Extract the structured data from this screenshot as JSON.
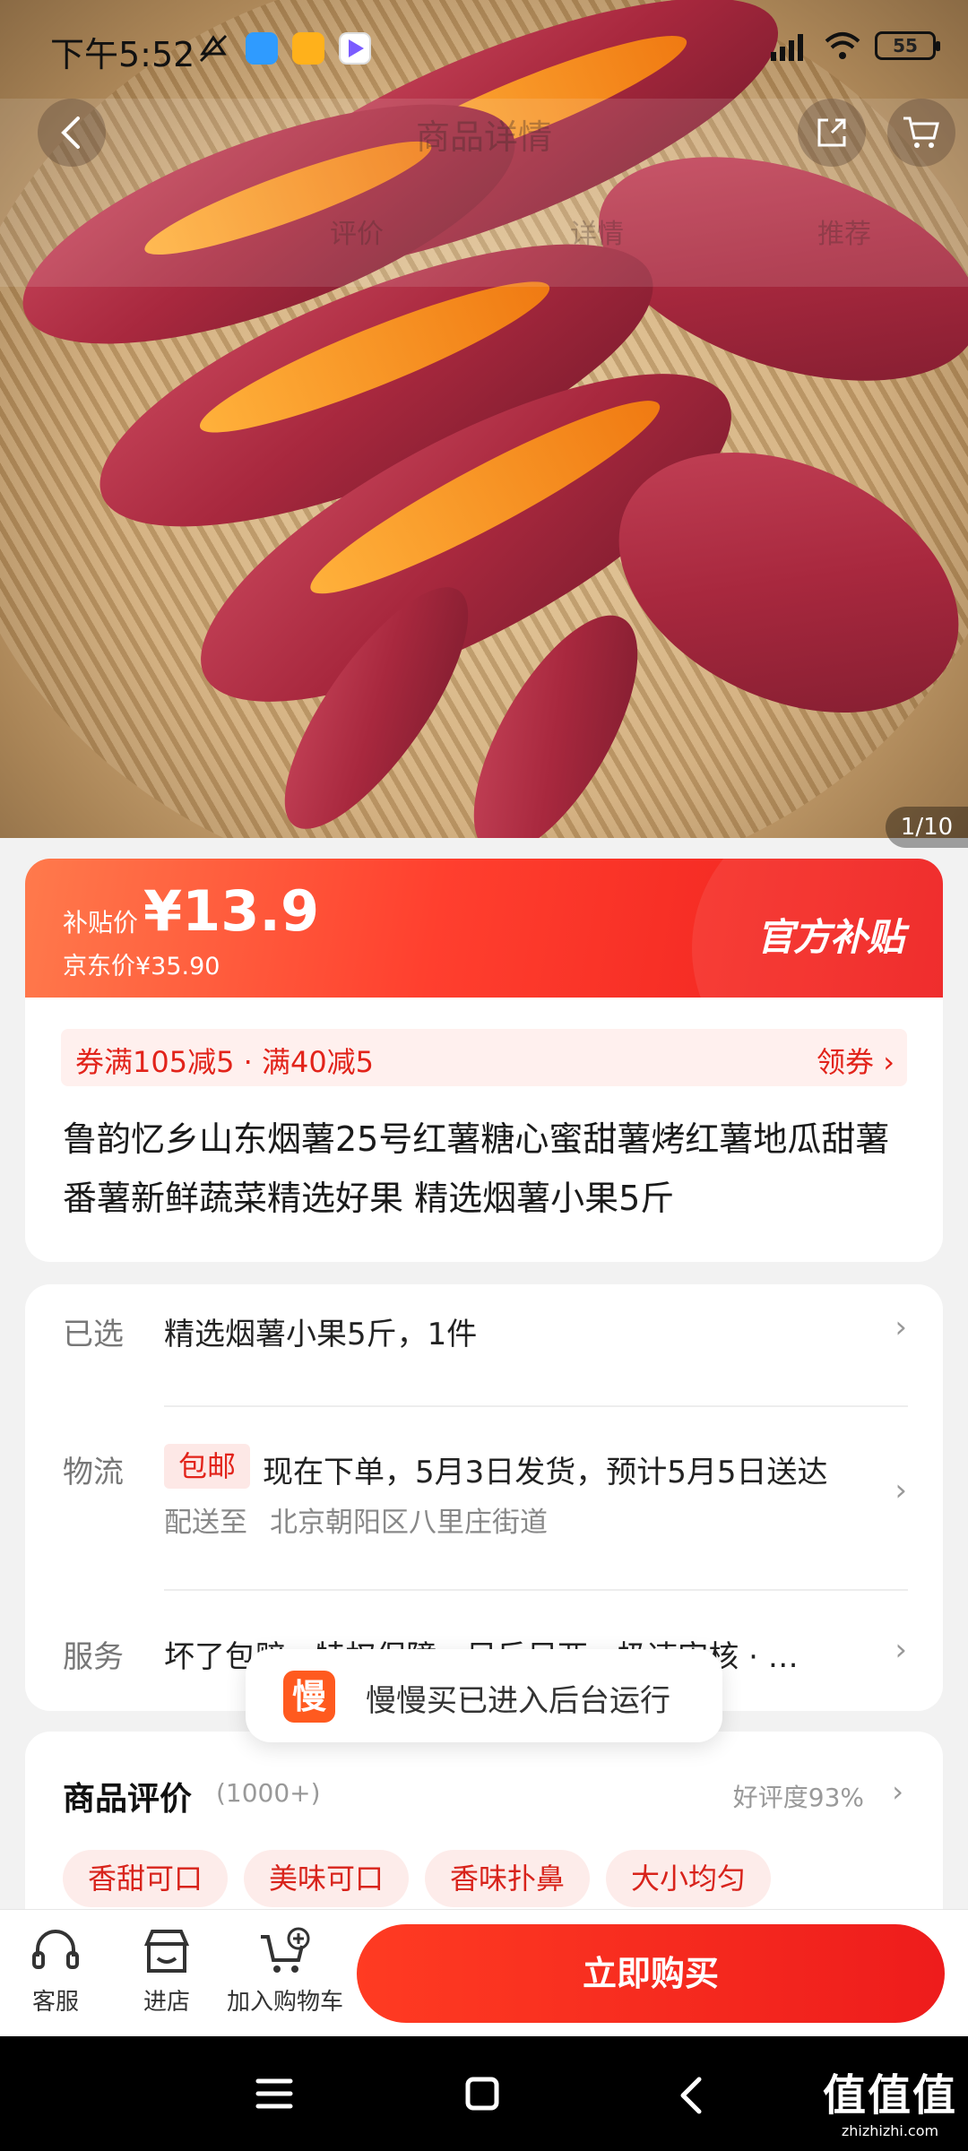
{
  "status_bar": {
    "time": "下午5:52",
    "battery": "55"
  },
  "nav": {
    "title": "商品详情",
    "tabs": [
      "评价",
      "详情",
      "推荐"
    ],
    "image_counter": "1/10"
  },
  "price_card": {
    "subsidy_label": "补贴价",
    "price": "¥13.9",
    "jd_price": "京东价¥35.90",
    "badge": "官方补贴",
    "coupon": "券满105减5 · 满40减5",
    "coupon_action": "领券 ›",
    "product_title": "鲁韵忆乡山东烟薯25号红薯糖心蜜甜薯烤红薯地瓜甜薯番薯新鲜蔬菜精选好果 精选烟薯小果5斤"
  },
  "spec_card": {
    "selected": {
      "label": "已选",
      "value": "精选烟薯小果5斤，1件"
    },
    "logistics": {
      "label": "物流",
      "tag": "包邮",
      "value": "现在下单，5月3日发货，预计5月5日送达",
      "deliver_label": "配送至",
      "address": "北京朝阳区八里庄街道"
    },
    "service": {
      "label": "服务",
      "value": "坏了包赔 · 特权保障 · 足斤足两 · 极速审核 · …"
    }
  },
  "toast": {
    "icon": "慢",
    "text": "慢慢买已进入后台运行"
  },
  "reviews": {
    "title": "商品评价",
    "count": "(1000+)",
    "rate": "好评度93%",
    "tags": [
      "香甜可口",
      "美味可口",
      "香味扑鼻",
      "大小均匀"
    ]
  },
  "action_bar": {
    "service": "客服",
    "store": "进店",
    "cart": "加入购物车",
    "buy": "立即购买"
  },
  "watermark": {
    "main": "值值值",
    "sub": "zhizhizhi.com"
  },
  "colors": {
    "accent": "#e2231a",
    "banner_start": "#ff7a4c",
    "banner_end": "#ee1c1c"
  }
}
